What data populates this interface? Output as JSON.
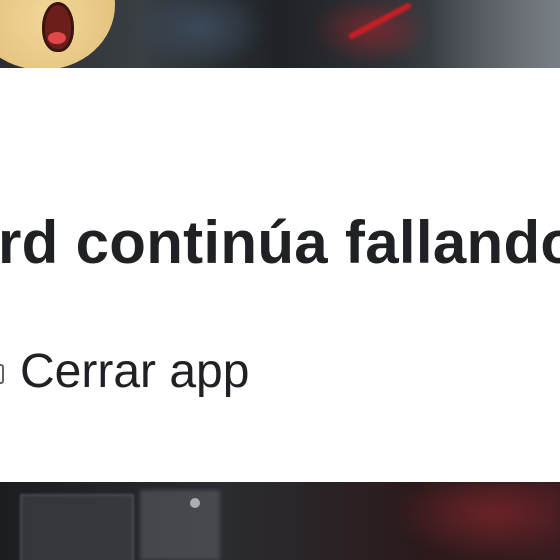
{
  "dialog": {
    "title": "rd continúa fallando",
    "close_app_label": "Cerrar app",
    "background_color": "#ffffff",
    "text_color": "#202124"
  },
  "icons": {
    "close_app_icon": "app-close-icon",
    "avatar": "cartoon-face-avatar"
  }
}
